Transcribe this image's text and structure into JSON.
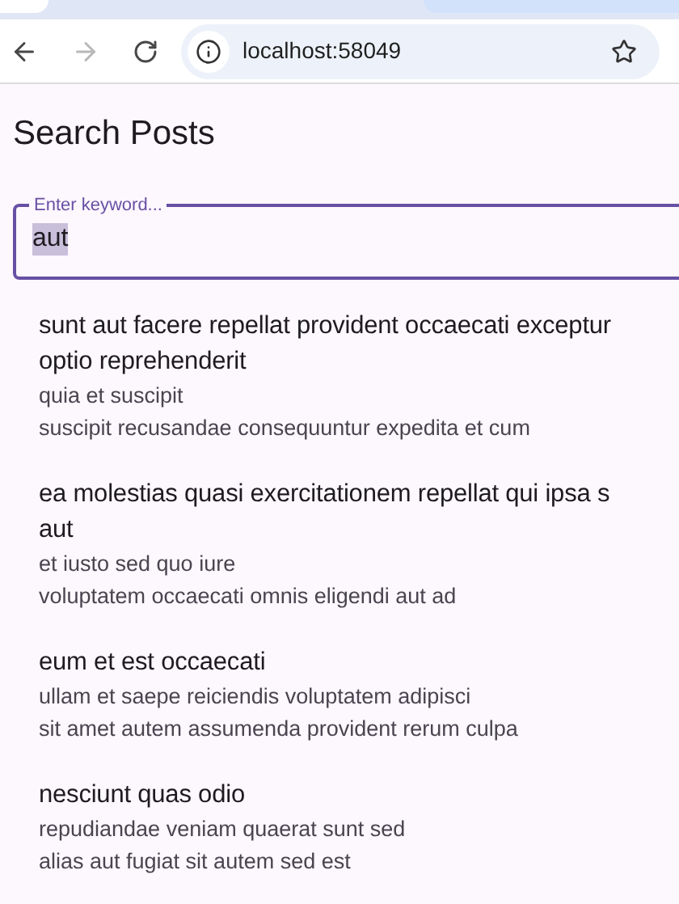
{
  "browser": {
    "url": "localhost:58049",
    "forward_disabled": true
  },
  "page": {
    "title": "Search Posts"
  },
  "search": {
    "label": "Enter keyword...",
    "value": "aut",
    "value_selected": true,
    "focused": true
  },
  "posts": [
    {
      "title_lines": [
        "sunt aut facere repellat provident occaecati exceptur",
        "optio reprehenderit"
      ],
      "body_lines": [
        "quia et suscipit",
        "suscipit recusandae consequuntur expedita et cum"
      ]
    },
    {
      "title_lines": [
        "ea molestias quasi exercitationem repellat qui ipsa s",
        "aut"
      ],
      "body_lines": [
        "et iusto sed quo iure",
        "voluptatem occaecati omnis eligendi aut ad"
      ]
    },
    {
      "title_lines": [
        "eum et est occaecati"
      ],
      "body_lines": [
        "ullam et saepe reiciendis voluptatem adipisci",
        "sit amet autem assumenda provident rerum culpa"
      ]
    },
    {
      "title_lines": [
        "nesciunt quas odio"
      ],
      "body_lines": [
        "repudiandae veniam quaerat sunt sed",
        "alias aut fugiat sit autem sed est"
      ]
    }
  ]
}
